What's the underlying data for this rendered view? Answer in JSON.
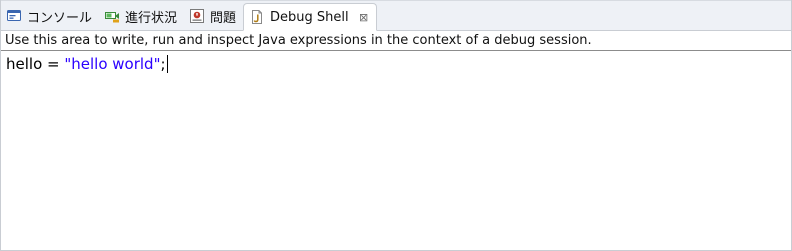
{
  "tabs": [
    {
      "label": "コンソール",
      "icon": "console-icon",
      "active": false
    },
    {
      "label": "進行状況",
      "icon": "progress-icon",
      "active": false
    },
    {
      "label": "問題",
      "icon": "problems-icon",
      "active": false
    },
    {
      "label": "Debug Shell",
      "icon": "java-file-icon",
      "active": true,
      "close_label": "⊠"
    }
  ],
  "description": "Use this area to write, run and inspect Java expressions in the context of a debug session.",
  "editor": {
    "code_prefix": "hello = ",
    "code_string": "\"hello world\"",
    "code_suffix": ";"
  },
  "colors": {
    "tab_bar_bg": "#eef1f6",
    "string_literal": "#2a00ff",
    "console_icon": "#3a66b0",
    "progress_icon": "#3a8a3a",
    "problems_icon": "#c0392b"
  }
}
